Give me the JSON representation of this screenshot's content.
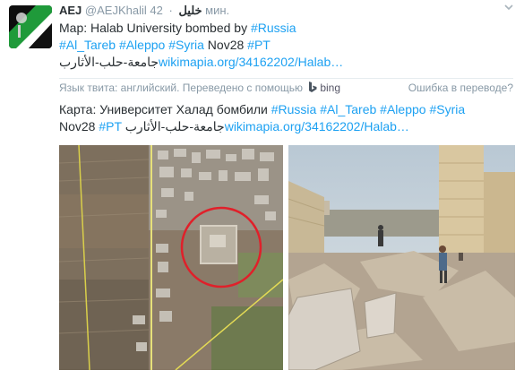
{
  "author": {
    "name": "AEJ",
    "handle": "@AEJKhalil",
    "handle_suffix": "خليل",
    "time": "42 мин."
  },
  "tweet": {
    "line1_text": "Map: Halab University bombed by ",
    "line1_tag": "#Russia",
    "line2_tags": [
      "#Al_Tareb",
      "#Aleppo",
      "#Syria"
    ],
    "line2_date": "Nov28",
    "line2_tag2": "#PT",
    "line3_arabic": "جامعة-حلب-الأثارب",
    "line3_link": "wikimapia.org/34162202/Halab…"
  },
  "translation": {
    "label": "Язык твита: английский. Переведено с помощью",
    "service": "bing",
    "error_link": "Ошибка в переводе?"
  },
  "translated": {
    "line1_text": "Карта: Университет Халад бомбили ",
    "line1_tags": [
      "#Russia",
      "#Al_Tareb",
      "#Aleppo",
      "#Syria"
    ],
    "line2_date": "Nov28",
    "line2_tag": "#PT",
    "line2_arabic": "جامعة-حلب-الأثارب",
    "line2_link": "wikimapia.org/34162202/Halab…"
  },
  "colors": {
    "link": "#1da1f2",
    "text": "#292f33",
    "muted": "#8899a6",
    "highlight_circle": "#e0202a"
  },
  "icons": [
    "chevron-down-icon",
    "bing-logo-icon"
  ]
}
